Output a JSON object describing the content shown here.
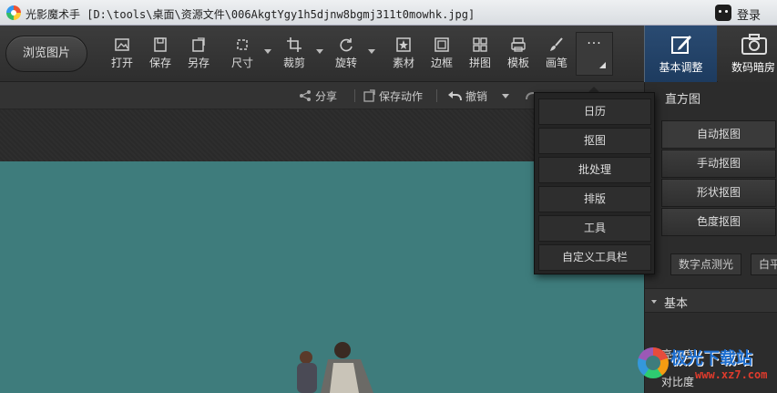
{
  "titlebar": {
    "title": "光影魔术手 [D:\\tools\\桌面\\资源文件\\006AkgtYgy1h5djnw8bgmj311t0mowhk.jpg]",
    "login_label": "登录"
  },
  "toolbar": {
    "browse_label": "浏览图片",
    "tools": [
      {
        "label": "打开",
        "icon": "open-icon"
      },
      {
        "label": "保存",
        "icon": "save-icon"
      },
      {
        "label": "另存",
        "icon": "save-as-icon"
      },
      {
        "label": "尺寸",
        "icon": "resize-icon"
      },
      {
        "label": "裁剪",
        "icon": "crop-icon"
      },
      {
        "label": "旋转",
        "icon": "rotate-icon"
      },
      {
        "label": "素材",
        "icon": "material-icon"
      },
      {
        "label": "边框",
        "icon": "frame-icon"
      },
      {
        "label": "拼图",
        "icon": "collage-icon"
      },
      {
        "label": "模板",
        "icon": "template-icon"
      },
      {
        "label": "画笔",
        "icon": "brush-icon"
      }
    ],
    "more_label": "···"
  },
  "right_tabs": {
    "basic_adjust": "基本调整",
    "digital_darkroom": "数码暗房"
  },
  "actionbar": {
    "share": "分享",
    "save_action": "保存动作",
    "undo": "撤销"
  },
  "dropdown_menu": {
    "items": [
      "日历",
      "抠图",
      "批处理",
      "排版",
      "工具",
      "自定义工具栏"
    ]
  },
  "right_panel": {
    "histogram_title": "直方图",
    "cutout_buttons": [
      "自动抠图",
      "手动抠图",
      "形状抠图",
      "色度抠图"
    ],
    "digital_spot_metering": "数字点测光",
    "white_balance_partial": "白平",
    "section_basic": "基本",
    "brightness_label": "亮　度",
    "contrast_label": "对比度"
  },
  "watermark": {
    "title": "极光下载站",
    "url": "www.xz7.com"
  },
  "colors": {
    "photo_background": "#3e7c7c",
    "active_tab": "#1d3b5f",
    "watermark_blue": "#1e6fd0",
    "watermark_red": "#e03b2c"
  }
}
